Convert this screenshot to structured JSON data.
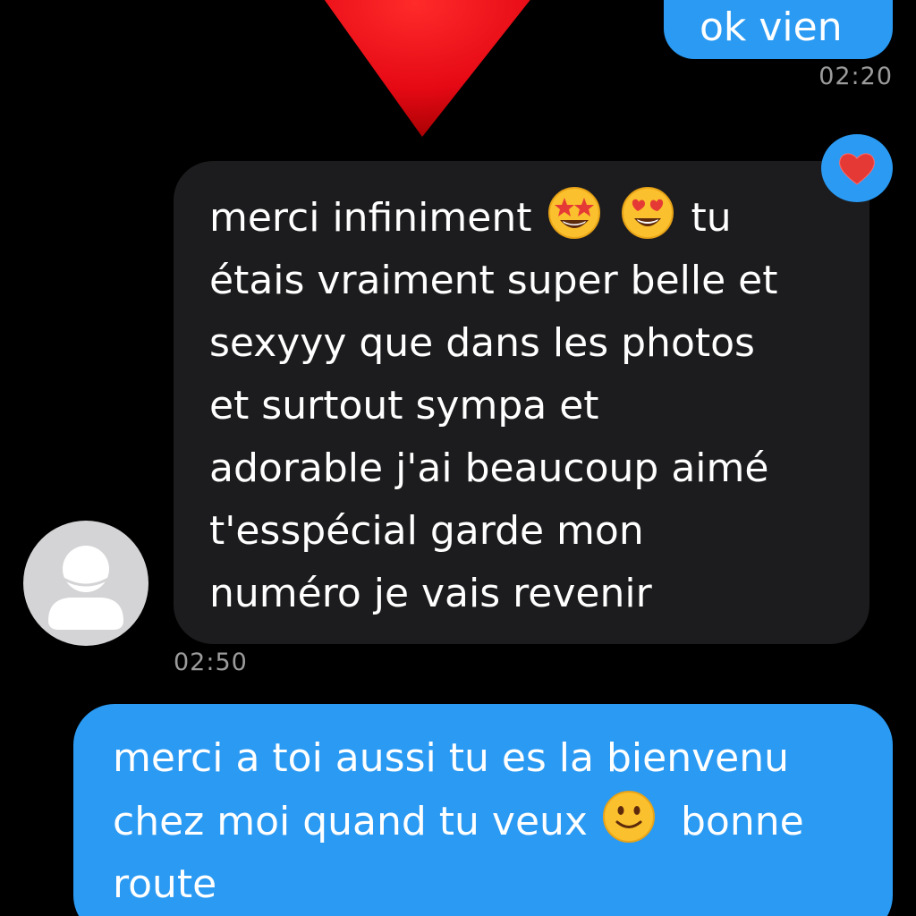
{
  "messages": {
    "top_outgoing": {
      "text": "ok vien",
      "time": "02:20"
    },
    "incoming": {
      "lines": [
        "merci infiniment",
        "tu",
        "étais vraiment super belle et",
        "sexyyy que dans les photos",
        "et surtout sympa et",
        "adorable j'ai beaucoup aimé",
        "t'esspécial garde mon",
        "numéro je vais revenir"
      ],
      "emojis": [
        "star-struck-emoji",
        "heart-eyes-emoji"
      ],
      "reaction": "red-heart-icon",
      "time": "02:50"
    },
    "bottom_outgoing": {
      "lines": [
        "merci a toi aussi tu es la bienvenu",
        "chez moi quand tu veux",
        "bonne",
        "route"
      ],
      "emoji": "slightly-smiling-emoji"
    }
  },
  "colors": {
    "background": "#000000",
    "outgoing_bubble": "#2a9af3",
    "incoming_bubble": "#1c1c1e",
    "timestamp": "#9b9b9b"
  }
}
